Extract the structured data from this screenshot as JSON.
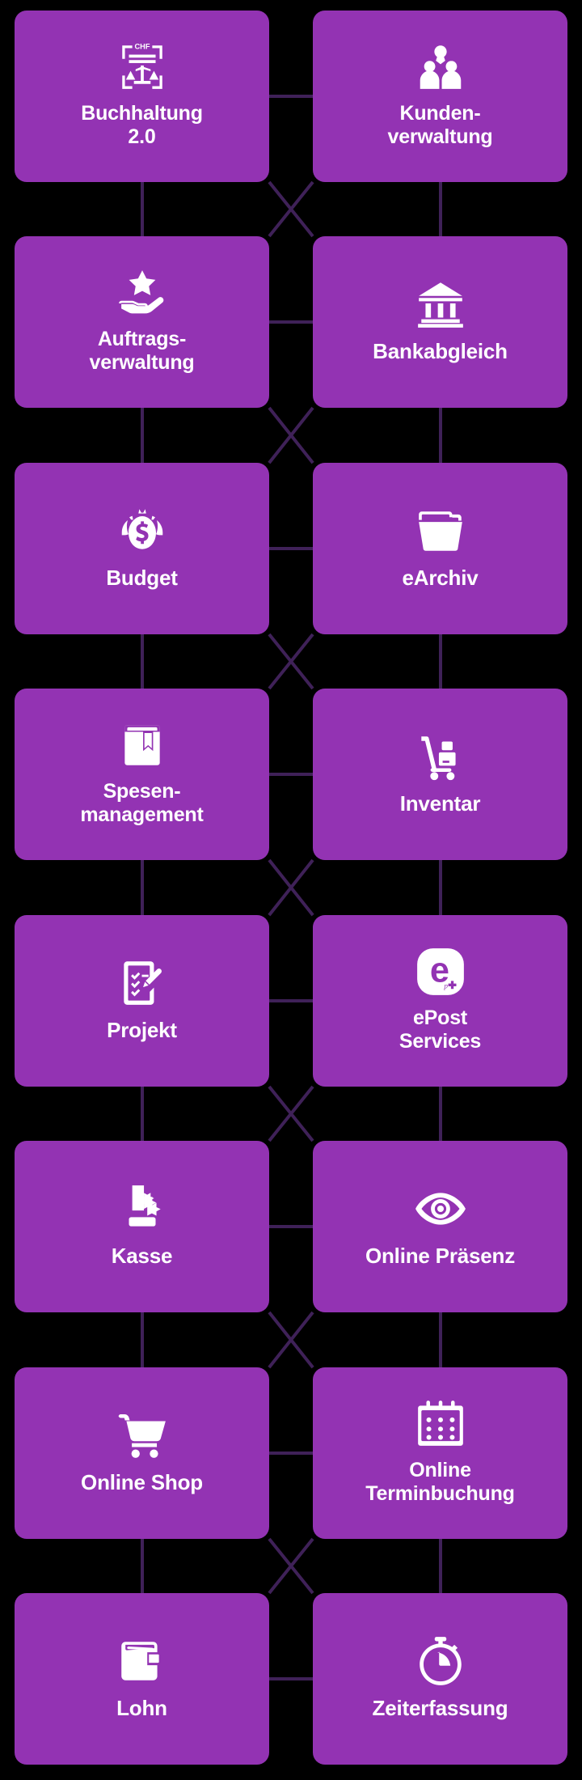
{
  "page": {
    "background_color": "#000000",
    "card_color": "#9333b3",
    "connector_color": "#3f2158",
    "text_color": "#ffffff",
    "columns": 2,
    "rows": 8,
    "total_cards": 16
  },
  "cards": [
    {
      "id": "buchhaltung",
      "label": "Buchhaltung\n2.0",
      "icon": "chf-document-scale-icon",
      "row": 1,
      "col": 1
    },
    {
      "id": "kundenverwaltung",
      "label": "Kunden-\nverwaltung",
      "icon": "people-group-icon",
      "row": 1,
      "col": 2
    },
    {
      "id": "auftragsverwaltung",
      "label": "Auftrags-\nverwaltung",
      "icon": "hand-star-icon",
      "row": 2,
      "col": 1
    },
    {
      "id": "bankabgleich",
      "label": "Bankabgleich",
      "icon": "bank-building-icon",
      "row": 2,
      "col": 2
    },
    {
      "id": "budget",
      "label": "Budget",
      "icon": "money-bag-icon",
      "row": 3,
      "col": 1
    },
    {
      "id": "earchiv",
      "label": "eArchiv",
      "icon": "folder-icon",
      "row": 3,
      "col": 2
    },
    {
      "id": "spesenmanagement",
      "label": "Spesen-\nmanagement",
      "icon": "bookmark-book-icon",
      "row": 4,
      "col": 1
    },
    {
      "id": "inventar",
      "label": "Inventar",
      "icon": "hand-truck-icon",
      "row": 4,
      "col": 2
    },
    {
      "id": "projekt",
      "label": "Projekt",
      "icon": "checklist-pen-icon",
      "row": 5,
      "col": 1
    },
    {
      "id": "epost-services",
      "label": "ePost\nServices",
      "icon": "epost-logo-icon",
      "row": 5,
      "col": 2
    },
    {
      "id": "kasse",
      "label": "Kasse",
      "icon": "cash-register-icon",
      "row": 6,
      "col": 1
    },
    {
      "id": "online-praesenz",
      "label": "Online Präsenz",
      "icon": "eye-icon",
      "row": 6,
      "col": 2
    },
    {
      "id": "online-shop",
      "label": "Online Shop",
      "icon": "shopping-cart-icon",
      "row": 7,
      "col": 1
    },
    {
      "id": "online-termin",
      "label": "Online\nTerminbuchung",
      "icon": "calendar-icon",
      "row": 7,
      "col": 2
    },
    {
      "id": "lohn",
      "label": "Lohn",
      "icon": "wallet-icon",
      "row": 8,
      "col": 1
    },
    {
      "id": "zeiterfassung",
      "label": "Zeiterfassung",
      "icon": "stopwatch-icon",
      "row": 8,
      "col": 2
    }
  ],
  "icon_badge_text": {
    "buchhaltung": "CHF",
    "epost": "e"
  }
}
